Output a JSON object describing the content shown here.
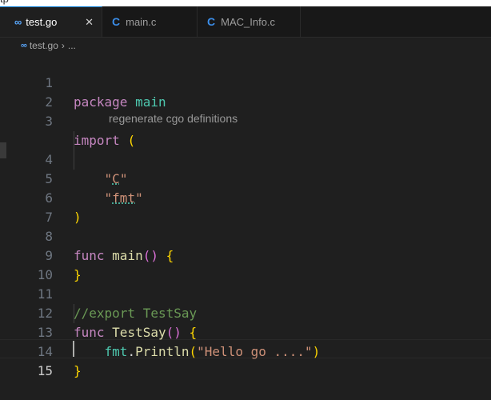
{
  "window": {
    "title_fragment": "tp"
  },
  "tabs": [
    {
      "label": "test.go",
      "icon": "go-icon",
      "active": true,
      "close": "✕"
    },
    {
      "label": "main.c",
      "icon": "c-language-icon",
      "active": false
    },
    {
      "label": "MAC_Info.c",
      "icon": "c-language-icon",
      "active": false
    }
  ],
  "breadcrumb": {
    "file": "test.go",
    "separator": "›",
    "rest": "..."
  },
  "code_lens": "regenerate cgo definitions",
  "lines": [
    {
      "n": "1",
      "t": "package main"
    },
    {
      "n": "2",
      "t": ""
    },
    {
      "n": "3",
      "t": "import ("
    },
    {
      "n": "4",
      "t": "    \"C\""
    },
    {
      "n": "5",
      "t": "    \"fmt\""
    },
    {
      "n": "6",
      "t": ")"
    },
    {
      "n": "7",
      "t": ""
    },
    {
      "n": "8",
      "t": "func main() {"
    },
    {
      "n": "9",
      "t": "}"
    },
    {
      "n": "10",
      "t": ""
    },
    {
      "n": "11",
      "t": "//export TestSay"
    },
    {
      "n": "12",
      "t": "func TestSay() {"
    },
    {
      "n": "13",
      "t": "    fmt.Println(\"Hello go ....\")"
    },
    {
      "n": "14",
      "t": "}"
    },
    {
      "n": "15",
      "t": ""
    }
  ],
  "tokens": {
    "package": "package",
    "main": "main",
    "import": "import",
    "open_paren": "(",
    "close_paren": ")",
    "quote": "\"",
    "C": "C",
    "fmt": "fmt",
    "func": "func",
    "parens": "()",
    "open_brace": "{",
    "close_brace": "}",
    "comment": "//export TestSay",
    "TestSay": "TestSay",
    "dot": ".",
    "Println": "Println",
    "hello": "\"Hello go ....\"",
    "indent": "    ",
    "space": " "
  },
  "colors": {
    "keyword": "#c586c0",
    "package_name": "#4ec9b0",
    "function": "#dcdcaa",
    "string": "#ce9178",
    "comment": "#6a9955",
    "bracket_1": "#da70d6",
    "bracket_2": "#179fff",
    "bracket_3": "#ffd700",
    "editor_bg": "#1f1f1f"
  }
}
